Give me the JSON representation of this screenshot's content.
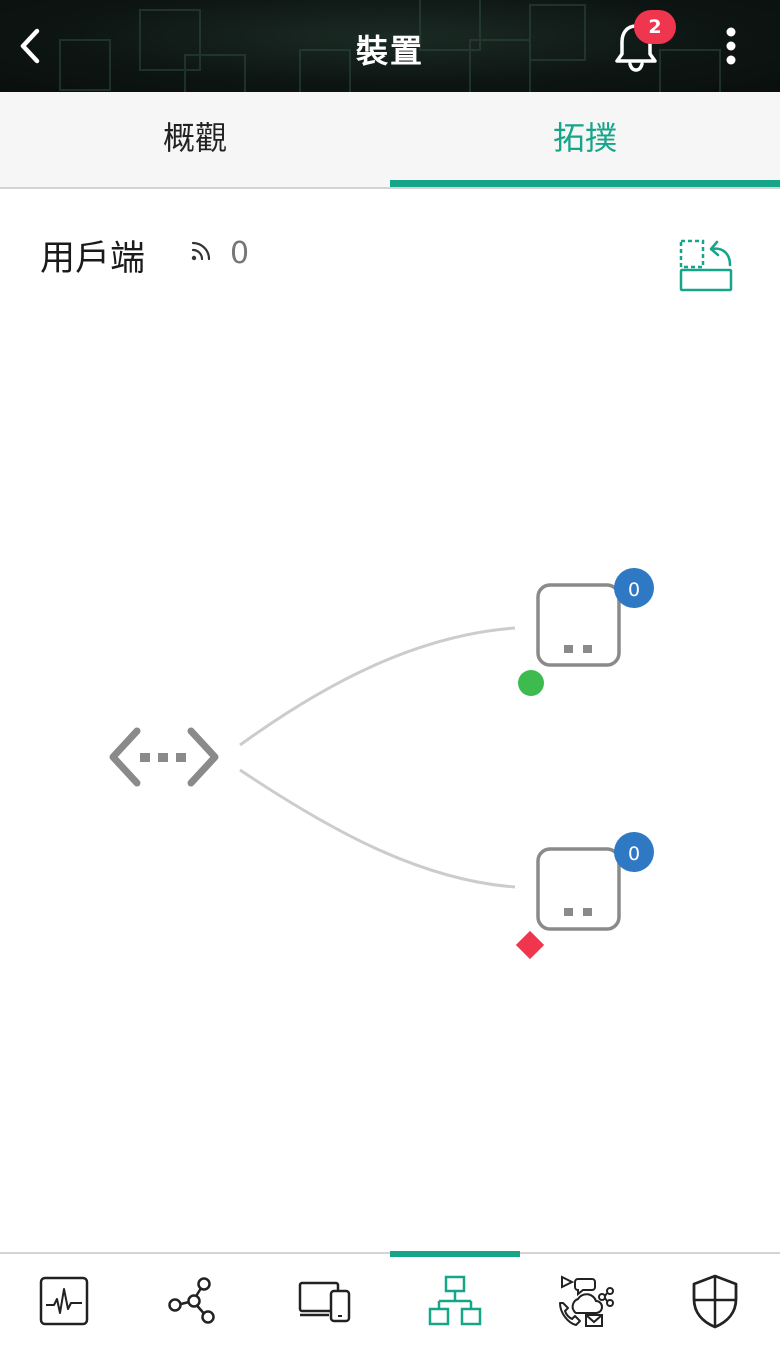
{
  "header": {
    "title": "裝置",
    "back_icon": "chevron-left-icon",
    "notification_icon": "bell-icon",
    "notification_count": "2",
    "more_icon": "vertical-dots-icon"
  },
  "tabs": [
    {
      "label": "概觀",
      "active": false
    },
    {
      "label": "拓撲",
      "active": true
    }
  ],
  "clients": {
    "label": "用戶端",
    "icon": "wifi-signal-icon",
    "count": "0",
    "action_icon": "rotate-layout-icon"
  },
  "topology": {
    "root": {
      "icon": "switch-icon"
    },
    "devices": [
      {
        "icon": "access-point-icon",
        "client_count": "0",
        "status": "online",
        "status_color": "#3dbb4f"
      },
      {
        "icon": "access-point-icon",
        "client_count": "0",
        "status": "offline",
        "status_color": "#f0364e"
      }
    ]
  },
  "bottom_nav": [
    {
      "icon": "activity-monitor-icon",
      "active": false
    },
    {
      "icon": "network-nodes-icon",
      "active": false
    },
    {
      "icon": "devices-icon",
      "active": false
    },
    {
      "icon": "topology-icon",
      "active": true
    },
    {
      "icon": "communications-icon",
      "active": false
    },
    {
      "icon": "shield-icon",
      "active": false
    }
  ],
  "colors": {
    "accent": "#17a589",
    "badge_blue": "#2f78c4",
    "badge_red": "#f0364e",
    "status_online": "#3dbb4f",
    "status_offline": "#f0364e"
  }
}
